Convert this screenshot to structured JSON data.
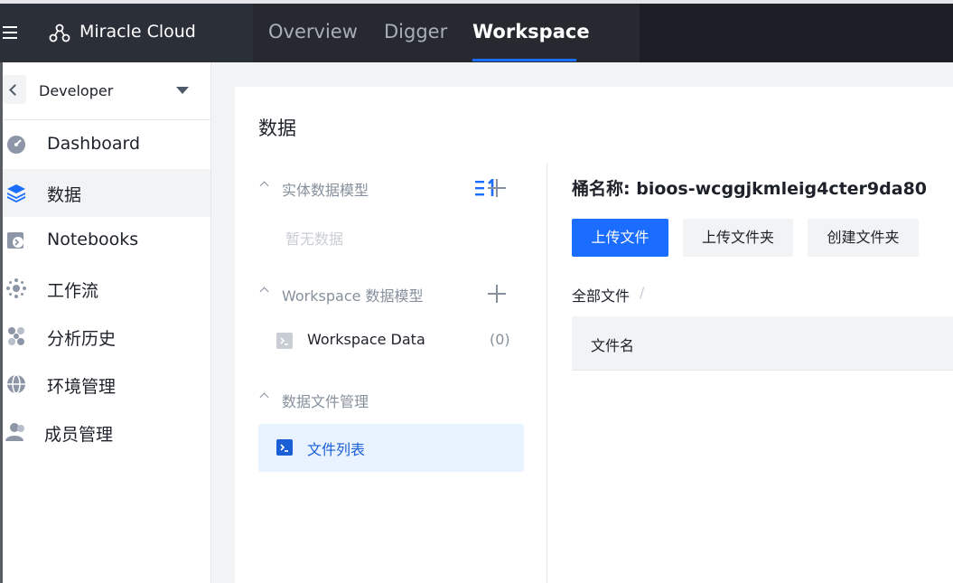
{
  "header": {
    "brand": "Miracle Cloud",
    "tabs": [
      {
        "label": "Overview",
        "active": false
      },
      {
        "label": "Digger",
        "active": false
      },
      {
        "label": "Workspace",
        "active": true
      }
    ]
  },
  "sidebar": {
    "workspace_selector": "Developer",
    "items": [
      {
        "label": "Dashboard",
        "icon": "dashboard-icon"
      },
      {
        "label": "数据",
        "icon": "layers-icon",
        "active": true
      },
      {
        "label": "Notebooks",
        "icon": "notebook-icon"
      },
      {
        "label": "工作流",
        "icon": "workflow-icon"
      },
      {
        "label": "分析历史",
        "icon": "history-icon"
      },
      {
        "label": "环境管理",
        "icon": "globe-icon"
      },
      {
        "label": "成员管理",
        "icon": "members-icon"
      }
    ]
  },
  "main": {
    "title": "数据",
    "sections": {
      "entity_model": {
        "label": "实体数据模型",
        "empty": "暂无数据"
      },
      "workspace_model": {
        "label": "Workspace 数据模型",
        "item_label": "Workspace Data",
        "item_count": "(0)"
      },
      "file_mgmt": {
        "label": "数据文件管理",
        "item_label": "文件列表"
      }
    },
    "bucket_label": "桶名称: bioos-wcggjkmleig4cter9da80",
    "buttons": {
      "upload_file": "上传文件",
      "upload_folder": "上传文件夹",
      "create_folder": "创建文件夹"
    },
    "breadcrumb": {
      "root": "全部文件",
      "sep": "/"
    },
    "table": {
      "col_name": "文件名"
    }
  },
  "colors": {
    "accent": "#1a6dff",
    "topbar": "#1c1f26"
  }
}
